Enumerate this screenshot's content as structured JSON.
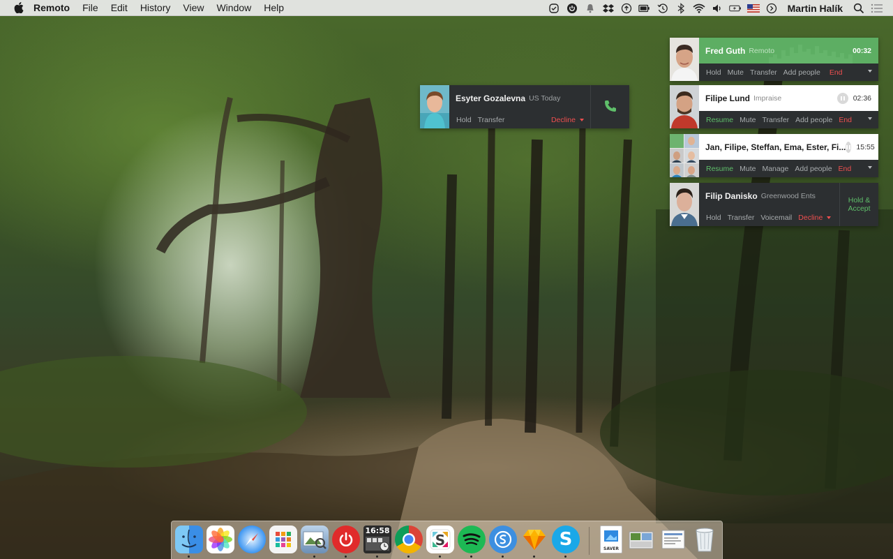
{
  "menubar": {
    "app_name": "Remoto",
    "menus": [
      "File",
      "Edit",
      "History",
      "View",
      "Window",
      "Help"
    ],
    "user_name": "Martin Halík",
    "status_icons": [
      "checkmark-circle-icon",
      "power-circle-icon",
      "bell-icon",
      "dropbox-icon",
      "upload-circle-icon",
      "display-battery-icon",
      "time-machine-icon",
      "bluetooth-icon",
      "wifi-icon",
      "volume-icon",
      "battery-charging-icon",
      "us-flag-icon",
      "clock-circle-icon",
      "search-icon",
      "list-icon"
    ]
  },
  "incoming_call": {
    "name": "Esyter Gozalevna",
    "company": "US Today",
    "actions": {
      "hold": "Hold",
      "transfer": "Transfer",
      "decline": "Decline"
    },
    "accept_icon": "phone-icon"
  },
  "calls": [
    {
      "name": "Fred Guth",
      "company": "Remoto",
      "timer": "00:32",
      "state": "active",
      "actions": [
        "Hold",
        "Mute",
        "Transfer",
        "Add people",
        "End"
      ]
    },
    {
      "name": "Filipe Lund",
      "company": "Impraise",
      "timer": "02:36",
      "state": "on-hold",
      "actions": [
        "Resume",
        "Mute",
        "Transfer",
        "Add people",
        "End"
      ]
    },
    {
      "name": "Jan, Filipe, Steffan, Ema, Ester, Fi...",
      "company": "",
      "timer": "15:55",
      "state": "on-hold-group",
      "actions": [
        "Resume",
        "Mute",
        "Manage",
        "Add people",
        "End"
      ]
    },
    {
      "name": "Filip Danisko",
      "company": "Greenwood Ents",
      "state": "incoming",
      "actions": [
        "Hold",
        "Transfer",
        "Voicemail",
        "Decline"
      ],
      "side_action": "Hold & Accept"
    }
  ],
  "dock": {
    "clock": "16:58",
    "apps": [
      "finder-icon",
      "photos-icon",
      "safari-icon",
      "launchpad-icon",
      "preview-icon",
      "power-app-icon",
      "clock-app-icon",
      "chrome-icon",
      "slack-icon",
      "spotify-icon",
      "simplenote-icon",
      "sketch-icon",
      "skype-icon",
      "saver-icon",
      "screenshot-folder-icon",
      "document-folder-icon",
      "trash-icon"
    ],
    "saver_label": "SAVER"
  },
  "colors": {
    "active_call": "#5dae63",
    "action_green": "#5fbf6a",
    "action_red": "#ef4f4f",
    "card_dark": "#2c2f31"
  }
}
